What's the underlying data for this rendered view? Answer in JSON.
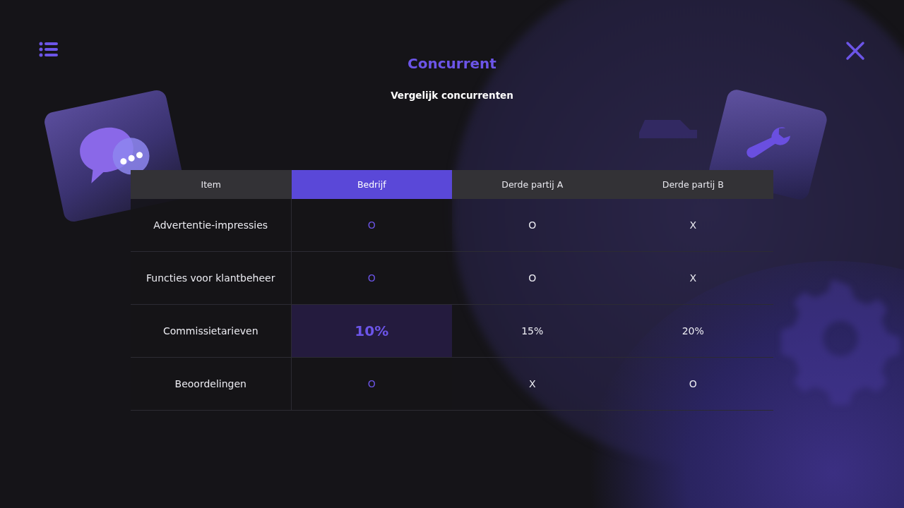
{
  "header": {
    "title": "Concurrent",
    "subtitle": "Vergelijk concurrenten"
  },
  "table": {
    "columns": [
      {
        "label": "Item",
        "selected": false
      },
      {
        "label": "Bedrijf",
        "selected": true
      },
      {
        "label": "Derde partij A",
        "selected": false
      },
      {
        "label": "Derde partij B",
        "selected": false
      }
    ],
    "rows": [
      {
        "cells": [
          "Advertentie-impressies",
          "O",
          "O",
          "X"
        ],
        "highlight": false
      },
      {
        "cells": [
          "Functies voor klantbeheer",
          "O",
          "O",
          "X"
        ],
        "highlight": false
      },
      {
        "cells": [
          "Commissietarieven",
          "10%",
          "15%",
          "20%"
        ],
        "highlight": true
      },
      {
        "cells": [
          "Beoordelingen",
          "O",
          "X",
          "O"
        ],
        "highlight": false
      }
    ]
  }
}
